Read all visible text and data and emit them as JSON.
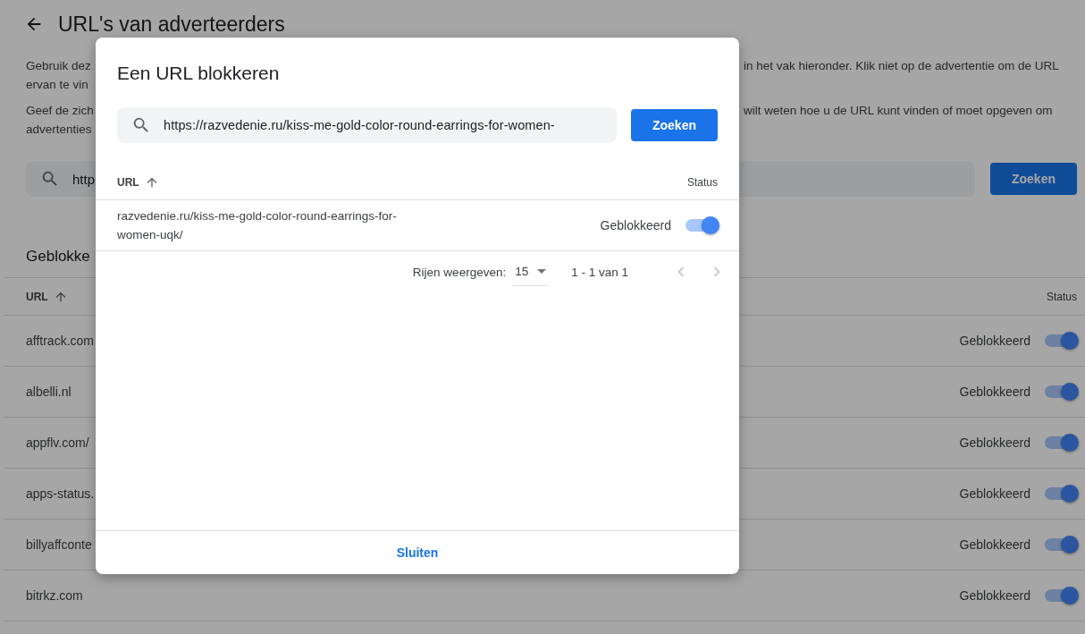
{
  "page": {
    "title": "URL's van adverteerders",
    "intro_left": [
      "Gebruik dez",
      "ervan te vin"
    ],
    "intro_right": "in het vak hieronder. Klik niet op de advertentie om de URL",
    "hint_left": [
      "Geef de zich",
      "advertenties"
    ],
    "hint_right": "wilt weten hoe u de URL kunt vinden of moet opgeven om",
    "search_value": "http",
    "search_button": "Zoeken",
    "section_title": "Geblokke",
    "columns": [
      "URL",
      "Status"
    ],
    "rows": [
      {
        "url": "afftrack.com",
        "status": "Geblokkeerd",
        "blocked": true
      },
      {
        "url": "albelli.nl",
        "status": "Geblokkeerd",
        "blocked": true
      },
      {
        "url": "appflv.com/",
        "status": "Geblokkeerd",
        "blocked": true
      },
      {
        "url": "apps-status.",
        "status": "Geblokkeerd",
        "blocked": true
      },
      {
        "url": "billyaffconte",
        "status": "Geblokkeerd",
        "blocked": true
      },
      {
        "url": "bitrkz.com",
        "status": "Geblokkeerd",
        "blocked": true
      }
    ]
  },
  "dialog": {
    "title": "Een URL blokkeren",
    "search_value": "https://razvedenie.ru/kiss-me-gold-color-round-earrings-for-women-",
    "search_button": "Zoeken",
    "columns": [
      "URL",
      "Status"
    ],
    "rows": [
      {
        "url": "razvedenie.ru/kiss-me-gold-color-round-earrings-for-women-uqk/",
        "status": "Geblokkeerd",
        "blocked": true
      }
    ],
    "rows_label": "Rijen weergeven:",
    "rows_per_page": "15",
    "range": "1 - 1 van 1",
    "prev_disabled": true,
    "next_disabled": true,
    "close_button": "Sluiten"
  }
}
